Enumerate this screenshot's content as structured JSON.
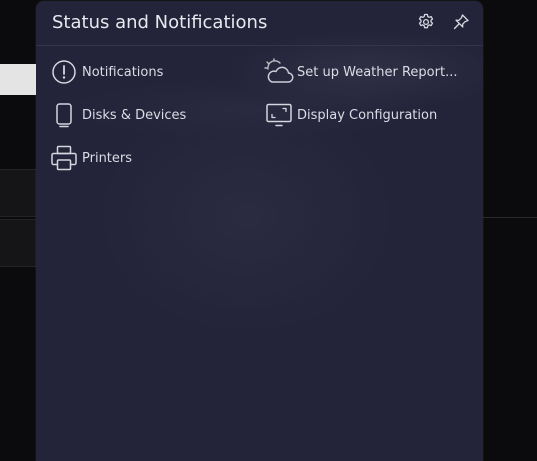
{
  "panel": {
    "title": "Status and Notifications",
    "configure_icon": "gear-icon",
    "pin_icon": "pin-icon"
  },
  "entries": [
    {
      "label": "Notifications",
      "icon": "info-icon"
    },
    {
      "label": "Set up Weather Report...",
      "icon": "weather-icon"
    },
    {
      "label": "Disks & Devices",
      "icon": "device-icon"
    },
    {
      "label": "Display Configuration",
      "icon": "display-icon"
    },
    {
      "label": "Printers",
      "icon": "printer-icon"
    }
  ],
  "colors": {
    "panel_background": "#23233a",
    "text": "#dcdce4",
    "icon": "#d6d6de"
  }
}
